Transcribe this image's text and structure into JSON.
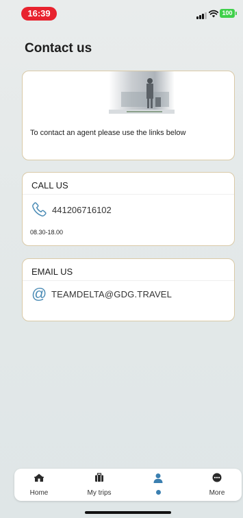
{
  "status_bar": {
    "time": "16:39",
    "battery": "100"
  },
  "page": {
    "title": "Contact us"
  },
  "intro_card": {
    "text": "To contact an agent please use the links below"
  },
  "call_card": {
    "header": "CALL US",
    "phone": "441206716102",
    "hours": "08.30-18.00",
    "icon": "phone-icon"
  },
  "email_card": {
    "header": "EMAIL US",
    "email": "TEAMDELTA@GDG.TRAVEL",
    "icon": "at-icon"
  },
  "tab_bar": {
    "tabs": [
      {
        "label": "Home",
        "icon": "home-icon"
      },
      {
        "label": "My trips",
        "icon": "suitcase-icon"
      },
      {
        "label": "",
        "icon": "contact-icon",
        "active": true
      },
      {
        "label": "More",
        "icon": "more-icon"
      }
    ]
  },
  "colors": {
    "time_pill": "#e8222e",
    "battery": "#3fd04a",
    "card_border": "#d9c9a6",
    "accent": "#4a8bb5"
  }
}
